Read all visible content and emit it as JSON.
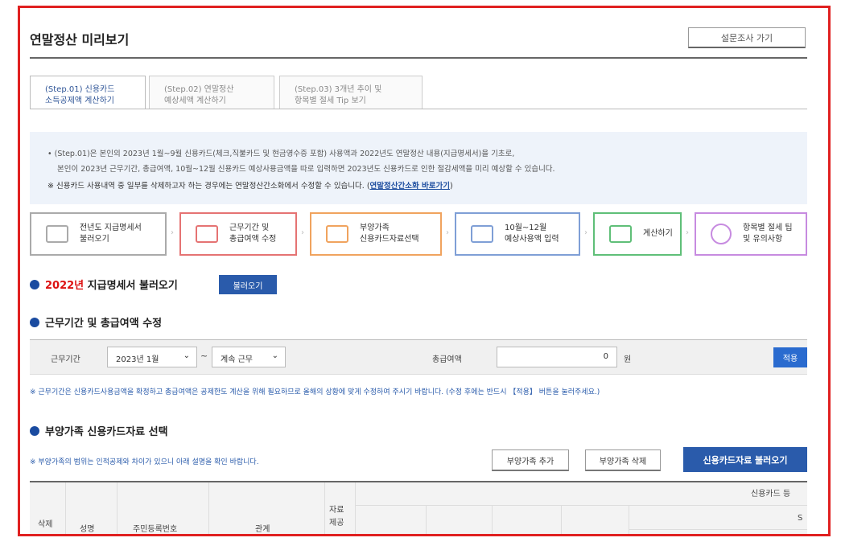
{
  "title": "연말정산 미리보기",
  "survey_button": "설문조사 가기",
  "tabs": [
    {
      "line1": "(Step.01) 신용카드",
      "line2": "소득공제액 계산하기"
    },
    {
      "line1": "(Step.02) 연말정산",
      "line2": "예상세액 계산하기"
    },
    {
      "line1": "(Step.03) 3개년 추이 및",
      "line2": "항목별 절세 Tip 보기"
    }
  ],
  "info": {
    "line1": "• (Step.01)은 본인의 2023년 1월~9월 신용카드(체크,직불카드 및 현금영수증 포함) 사용액과 2022년도 연말정산 내용(지급명세서)을 기초로,",
    "line2": "본인이 2023년 근무기간, 총급여액, 10월~12월 신용카드 예상사용금액을 따로 입력하면 2023년도 신용카드로 인한 절감세액을 미리 예상할 수 있습니다.",
    "line3_prefix": "※ 신용카드 사용내역 중 일부를 삭제하고자 하는 경우에는 연말정산간소화에서 수정할 수 있습니다. (",
    "line3_link": "연말정산간소화 바로가기",
    "line3_suffix": ")"
  },
  "steps": [
    {
      "line1": "전년도 지급명세서",
      "line2": "불러오기",
      "icon": "document-icon",
      "color": "#aaaaaa"
    },
    {
      "line1": "근무기간 및",
      "line2": "총급여액 수정",
      "icon": "calendar-icon",
      "color": "#e57373"
    },
    {
      "line1": "부양가족",
      "line2": "신용카드자료선택",
      "icon": "monitor-icon",
      "color": "#f0a35e"
    },
    {
      "line1": "10월~12월",
      "line2": "예상사용액 입력",
      "icon": "card-icon",
      "color": "#7f9fd6"
    },
    {
      "line1": "계산하기",
      "line2": "",
      "icon": "calculator-icon",
      "color": "#5fbf78"
    },
    {
      "line1": "항목별 절세 팁",
      "line2": "및 유의사항",
      "icon": "tip-icon",
      "color": "#c78be0"
    }
  ],
  "section1": {
    "year": "2022년",
    "title": " 지급명세서 불러오기",
    "button": "불러오기"
  },
  "section2": {
    "title": "근무기간 및 총급여액 수정",
    "period_label": "근무기간",
    "start": "2023년 1월",
    "tilde": "~",
    "end": "계속 근무",
    "total_label": "총급여액",
    "total_value": "0",
    "unit": "원",
    "apply": "적용",
    "note": "※ 근무기간은 신용카드사용금액을 확정하고 총급여액은 공제한도 계산을 위해 필요하므로 올해의 상황에 맞게 수정하여 주시기 바랍니다. (수정 후에는 반드시 【적용】 버튼을 눌러주세요.)"
  },
  "section3": {
    "title": "부양가족 신용카드자료 선택",
    "note": "※ 부양가족의 범위는 인적공제와 차이가 있으니 아래 설명을 확인 바랍니다.",
    "add_button": "부양가족 추가",
    "delete_button": "부양가족 삭제",
    "load_button": "신용카드자료 불러오기"
  },
  "table": {
    "delete": "삭제",
    "name": "성명",
    "rrn": "주민등록번호",
    "relation": "관계",
    "provide_l1": "자료",
    "provide_l2": "제공",
    "card_group": "신용카드 등",
    "sub_s": "S"
  }
}
